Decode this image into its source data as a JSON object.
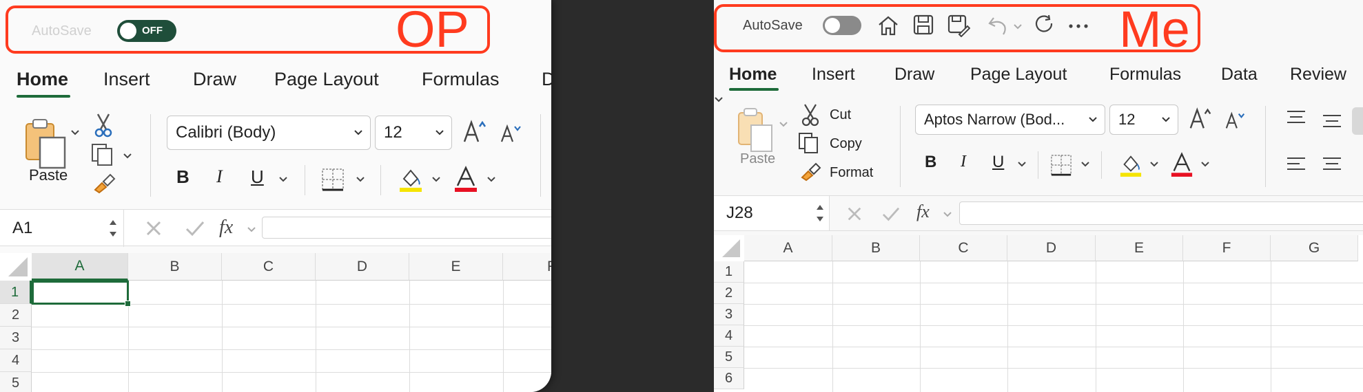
{
  "op_panel": {
    "callout_label": "OP",
    "autosave_label": "AutoSave",
    "autosave_state": "OFF",
    "tabs": [
      "Home",
      "Insert",
      "Draw",
      "Page Layout",
      "Formulas",
      "D"
    ],
    "paste_label": "Paste",
    "font_name": "Calibri (Body)",
    "font_size": "12",
    "name_box": "A1",
    "columns": [
      "A",
      "B",
      "C",
      "D",
      "E",
      "F"
    ],
    "rows": [
      "1",
      "2",
      "3",
      "4",
      "5"
    ]
  },
  "me_panel": {
    "callout_label": "Me",
    "autosave_label": "AutoSave",
    "tabs": [
      "Home",
      "Insert",
      "Draw",
      "Page Layout",
      "Formulas",
      "Data",
      "Review"
    ],
    "paste_label": "Paste",
    "cut_label": "Cut",
    "copy_label": "Copy",
    "format_label": "Format",
    "font_name": "Aptos Narrow (Bod...",
    "font_size": "12",
    "name_box": "J28",
    "columns": [
      "A",
      "B",
      "C",
      "D",
      "E",
      "F",
      "G"
    ],
    "rows": [
      "1",
      "2",
      "3",
      "4",
      "5",
      "6"
    ]
  },
  "colors": {
    "callout": "#ff3b1f",
    "excel_green": "#1e6b3a",
    "highlight_yellow": "#f5e400",
    "font_red": "#e81123"
  },
  "icons": [
    "home-icon",
    "save-icon",
    "save-as-icon",
    "undo-icon",
    "redo-icon",
    "more-icon",
    "scissors-icon",
    "copy-icon",
    "format-painter-icon",
    "clipboard-icon",
    "borders-icon",
    "fill-color-icon",
    "font-color-icon",
    "increase-font-icon",
    "decrease-font-icon",
    "cancel-icon",
    "confirm-icon",
    "fx-icon",
    "align-icon"
  ]
}
